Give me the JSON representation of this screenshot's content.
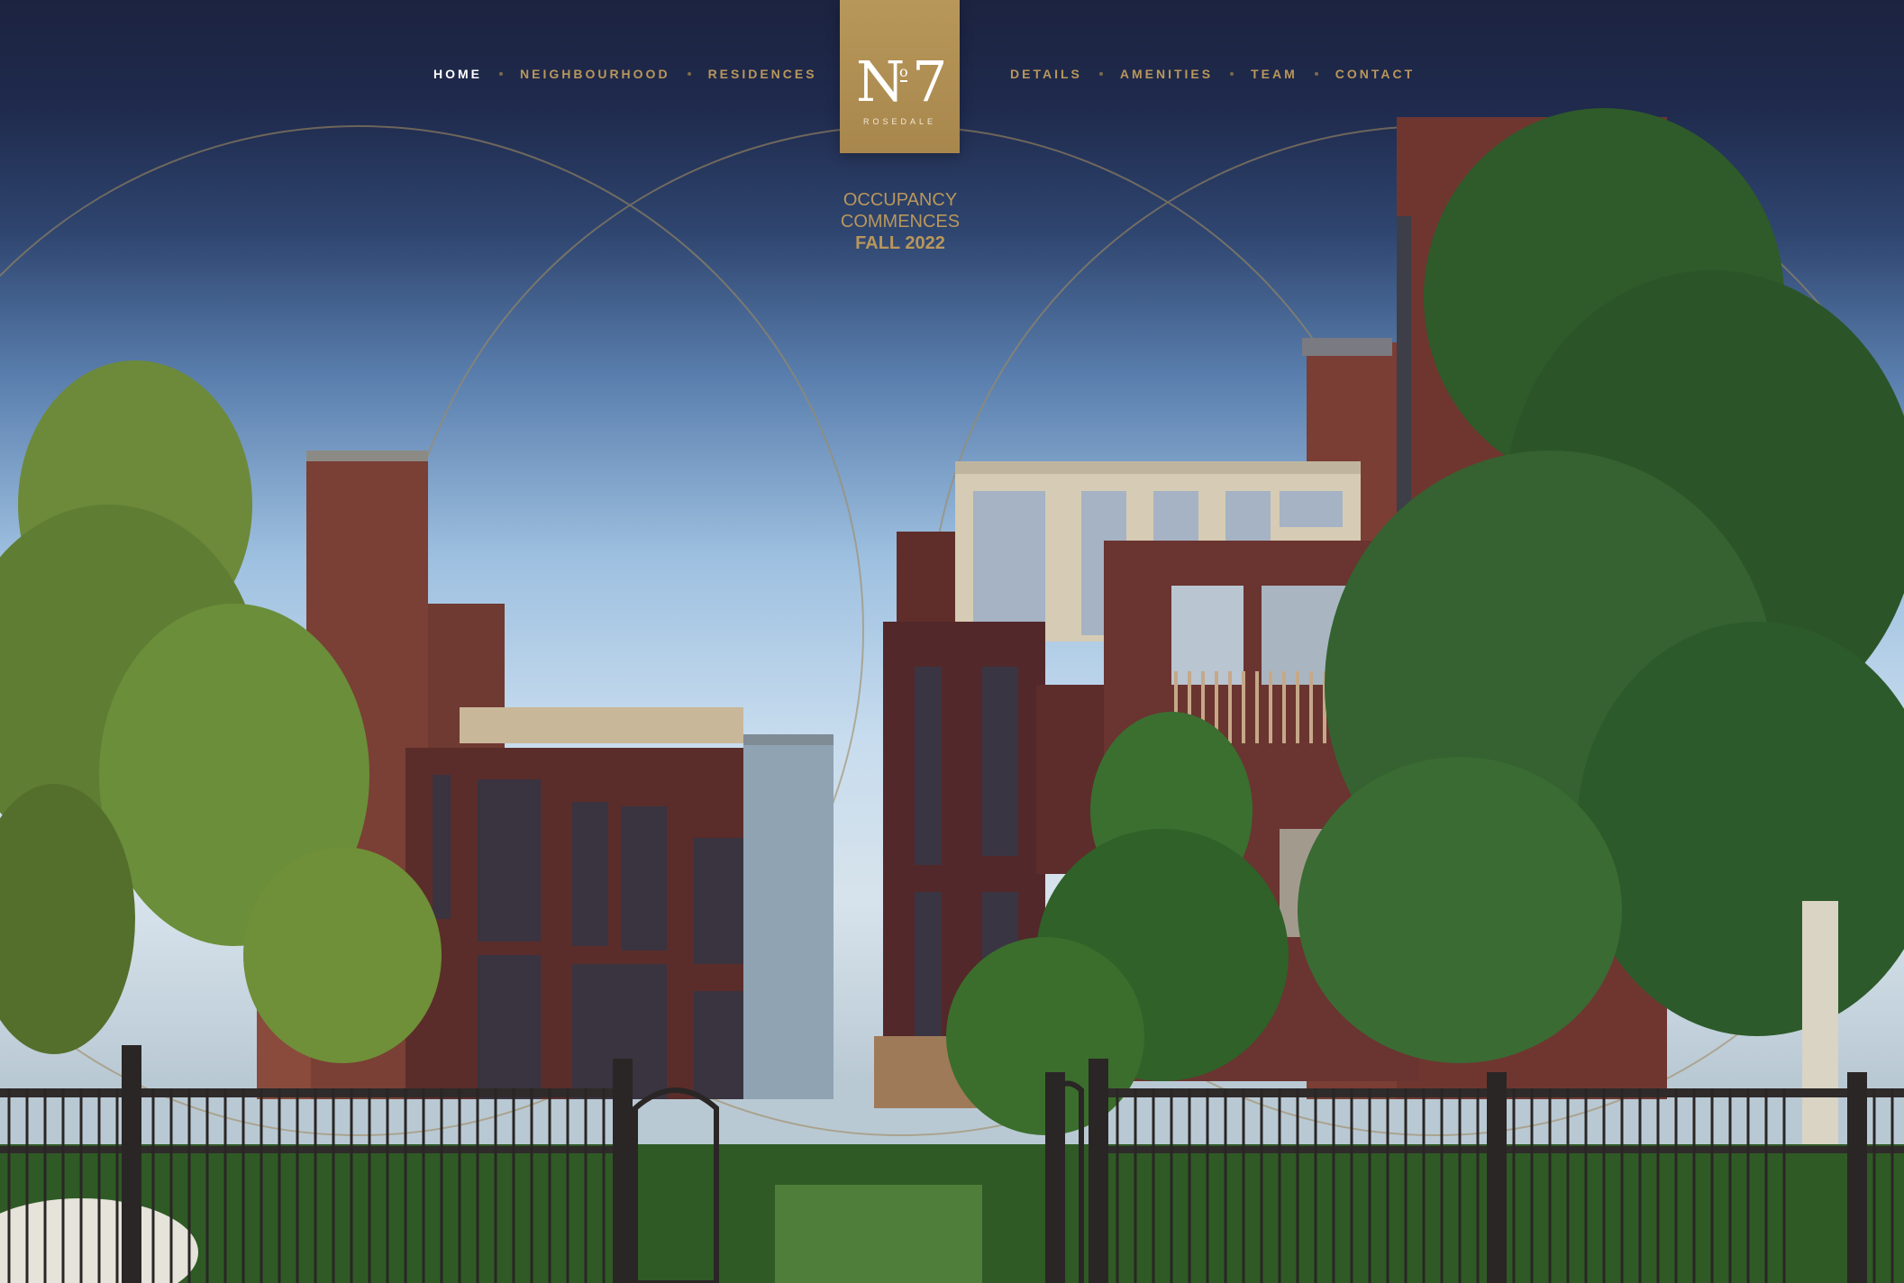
{
  "nav": {
    "left": [
      {
        "label": "HOME",
        "active": true
      },
      {
        "label": "NEIGHBOURHOOD",
        "active": false
      },
      {
        "label": "RESIDENCES",
        "active": false
      }
    ],
    "right": [
      {
        "label": "DETAILS",
        "active": false
      },
      {
        "label": "AMENITIES",
        "active": false
      },
      {
        "label": "TEAM",
        "active": false
      },
      {
        "label": "CONTACT",
        "active": false
      }
    ]
  },
  "logo": {
    "letter": "N",
    "superscript": "o",
    "number": "7",
    "subtitle": "ROSEDALE"
  },
  "banner": {
    "line1": "OCCUPANCY",
    "line2": "COMMENCES",
    "line3": "FALL 2022"
  },
  "colors": {
    "gold": "#b9975b",
    "navy": "#1c2240",
    "active_nav": "#ffffff"
  }
}
